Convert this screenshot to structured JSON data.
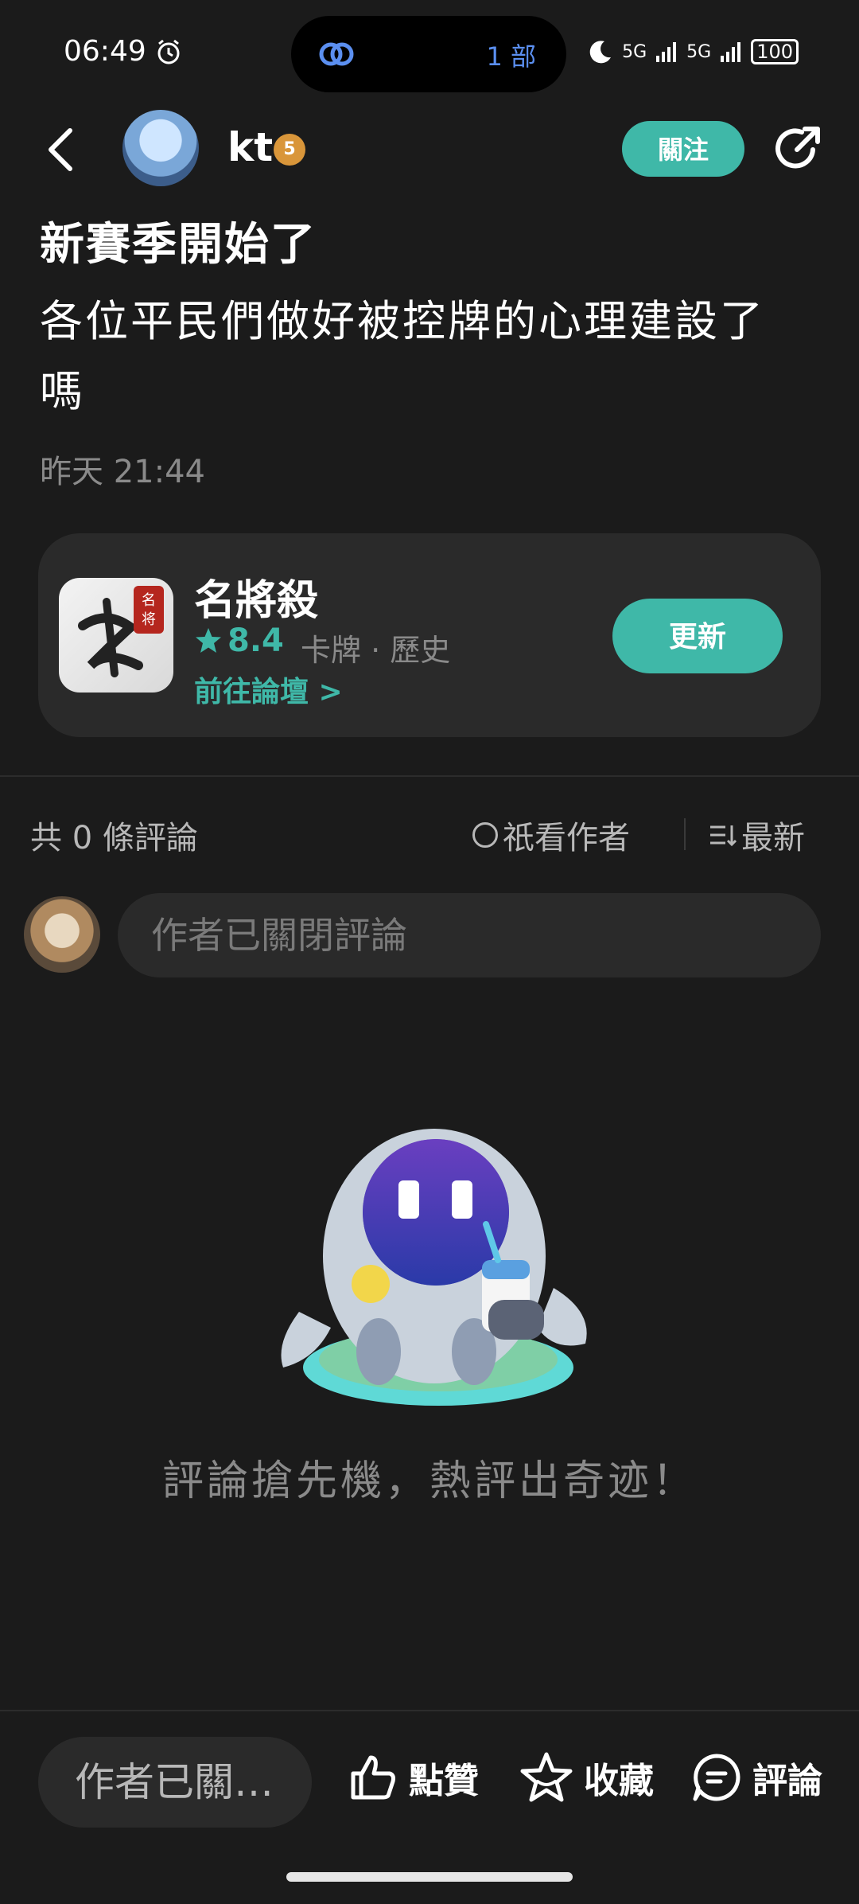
{
  "status_bar": {
    "time": "06:49",
    "island_text": "1 部",
    "signal_1": "5G",
    "signal_2": "5G",
    "battery": "100"
  },
  "header": {
    "username": "kt",
    "level": "5",
    "follow_label": "關注"
  },
  "post": {
    "title": "新賽季開始了",
    "body": "各位平民們做好被控牌的心理建設了嗎",
    "time": "昨天 21:44"
  },
  "game": {
    "name": "名將殺",
    "icon_text": "名将",
    "rating": "8.4",
    "tags": "卡牌 · 歷史",
    "forum_link": "前往論壇 >",
    "update_label": "更新"
  },
  "comments": {
    "count_label": "共 0 條評論",
    "author_only_label": "祇看作者",
    "sort_label": "最新",
    "input_placeholder": "作者已關閉評論",
    "empty_text": "評論搶先機，熱評出奇迹！"
  },
  "bottom_bar": {
    "input_text": "作者已關…",
    "like_label": "點贊",
    "favorite_label": "收藏",
    "comment_label": "評論"
  },
  "colors": {
    "accent": "#3fb8a8",
    "background": "#1b1b1b",
    "card": "#2a2a2a"
  }
}
